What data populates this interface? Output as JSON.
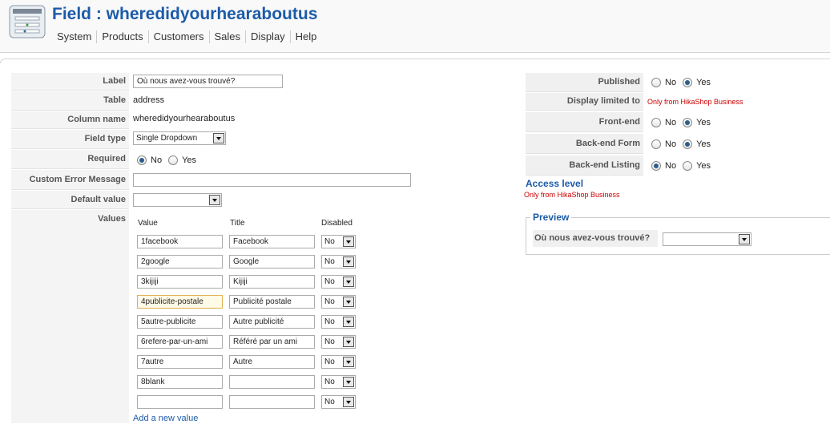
{
  "header": {
    "title": "Field : wheredidyourhearaboutus",
    "menu": [
      "System",
      "Products",
      "Customers",
      "Sales",
      "Display",
      "Help"
    ]
  },
  "form": {
    "label": {
      "caption": "Label",
      "value": "Où nous avez-vous trouvé?"
    },
    "table": {
      "caption": "Table",
      "value": "address"
    },
    "column_name": {
      "caption": "Column name",
      "value": "wheredidyourhearaboutus"
    },
    "field_type": {
      "caption": "Field type",
      "value": "Single Dropdown"
    },
    "required": {
      "caption": "Required",
      "options": [
        "No",
        "Yes"
      ],
      "selected": "No"
    },
    "custom_error": {
      "caption": "Custom Error Message",
      "value": ""
    },
    "default_value": {
      "caption": "Default value",
      "value": ""
    },
    "values": {
      "caption": "Values",
      "columns": [
        "Value",
        "Title",
        "Disabled"
      ],
      "rows": [
        {
          "value": "1facebook",
          "title": "Facebook",
          "disabled": "No"
        },
        {
          "value": "2google",
          "title": "Google",
          "disabled": "No"
        },
        {
          "value": "3kijiji",
          "title": "Kijiji",
          "disabled": "No"
        },
        {
          "value": "4publicite-postale",
          "title": "Publicité postale",
          "disabled": "No"
        },
        {
          "value": "5autre-publicite",
          "title": "Autre publicité",
          "disabled": "No"
        },
        {
          "value": "6refere-par-un-ami",
          "title": "Référé par un ami",
          "disabled": "No"
        },
        {
          "value": "7autre",
          "title": "Autre",
          "disabled": "No"
        },
        {
          "value": "8blank",
          "title": "",
          "disabled": "No"
        },
        {
          "value": "",
          "title": "",
          "disabled": "No"
        }
      ],
      "add_link": "Add a new value"
    }
  },
  "settings": {
    "published": {
      "caption": "Published",
      "options": [
        "No",
        "Yes"
      ],
      "selected": "Yes"
    },
    "display_limited": {
      "caption": "Display limited to",
      "note": "Only from HikaShop Business"
    },
    "front_end": {
      "caption": "Front-end",
      "options": [
        "No",
        "Yes"
      ],
      "selected": "Yes"
    },
    "backend_form": {
      "caption": "Back-end Form",
      "options": [
        "No",
        "Yes"
      ],
      "selected": "Yes"
    },
    "backend_listing": {
      "caption": "Back-end Listing",
      "options": [
        "No",
        "Yes"
      ],
      "selected": "No"
    },
    "access_level": {
      "title": "Access level",
      "note": "Only from HikaShop Business"
    }
  },
  "preview": {
    "legend": "Preview",
    "label": "Où nous avez-vous trouvé?",
    "value": ""
  }
}
